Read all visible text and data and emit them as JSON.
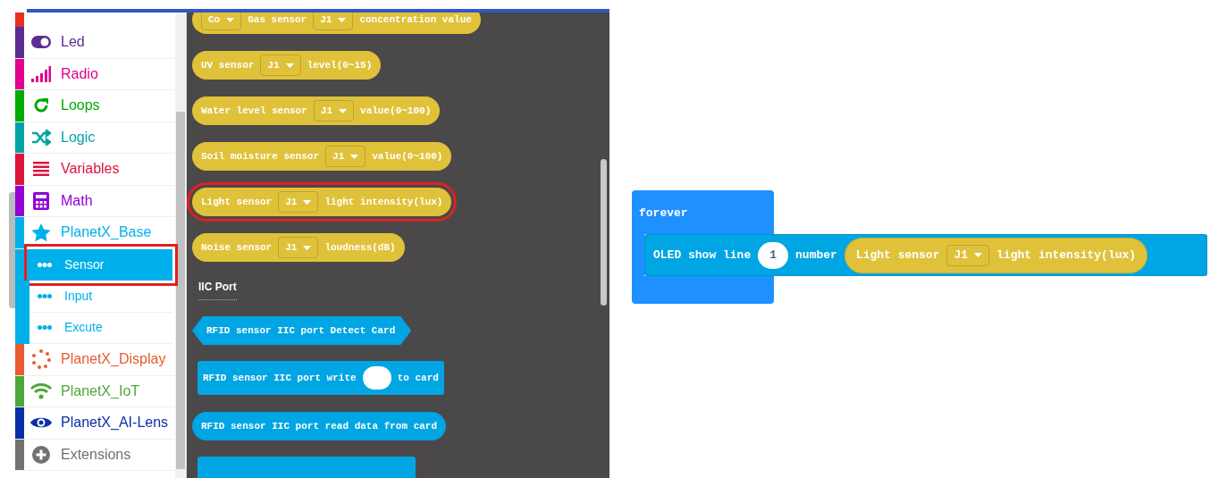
{
  "sidebar": {
    "items": [
      {
        "label": "Led",
        "color": "#5c2d91",
        "selected": false
      },
      {
        "label": "Radio",
        "color": "#e3008c",
        "selected": false
      },
      {
        "label": "Loops",
        "color": "#00aa00",
        "selected": false
      },
      {
        "label": "Logic",
        "color": "#00a4a6",
        "selected": false
      },
      {
        "label": "Variables",
        "color": "#dc143c",
        "selected": false
      },
      {
        "label": "Math",
        "color": "#9400d3",
        "selected": false
      },
      {
        "label": "PlanetX_Base",
        "color": "#00b0ea",
        "selected": false,
        "children": [
          {
            "label": "Sensor",
            "selected": true,
            "highlighted": true
          },
          {
            "label": "Input",
            "selected": false,
            "highlighted": false
          },
          {
            "label": "Excute",
            "selected": false,
            "highlighted": false
          }
        ]
      },
      {
        "label": "PlanetX_Display",
        "color": "#e95b30",
        "selected": false
      },
      {
        "label": "PlanetX_IoT",
        "color": "#4ea73a",
        "selected": false
      },
      {
        "label": "PlanetX_AI-Lens",
        "color": "#0a2ea8",
        "selected": false
      },
      {
        "label": "Extensions",
        "color": "#717171",
        "selected": false
      }
    ]
  },
  "flyout": {
    "items": [
      {
        "kind": "reporter",
        "color": "#e0c23a",
        "highlighted": false,
        "parts": [
          {
            "kind": "dropdown",
            "text": "Co"
          },
          {
            "kind": "text",
            "text": "Gas sensor"
          },
          {
            "kind": "dropdown",
            "text": "J1"
          },
          {
            "kind": "text",
            "text": "concentration value"
          }
        ]
      },
      {
        "kind": "reporter",
        "color": "#e0c23a",
        "highlighted": false,
        "parts": [
          {
            "kind": "text",
            "text": "UV sensor"
          },
          {
            "kind": "dropdown",
            "text": "J1"
          },
          {
            "kind": "text",
            "text": "level(0~15)"
          }
        ]
      },
      {
        "kind": "reporter",
        "color": "#e0c23a",
        "highlighted": false,
        "parts": [
          {
            "kind": "text",
            "text": "Water level sensor"
          },
          {
            "kind": "dropdown",
            "text": "J1"
          },
          {
            "kind": "text",
            "text": "value(0~100)"
          }
        ]
      },
      {
        "kind": "reporter",
        "color": "#e0c23a",
        "highlighted": false,
        "parts": [
          {
            "kind": "text",
            "text": "Soil moisture sensor"
          },
          {
            "kind": "dropdown",
            "text": "J1"
          },
          {
            "kind": "text",
            "text": "value(0~100)"
          }
        ]
      },
      {
        "kind": "reporter",
        "color": "#e0c23a",
        "highlighted": true,
        "parts": [
          {
            "kind": "text",
            "text": "Light sensor"
          },
          {
            "kind": "dropdown",
            "text": "J1"
          },
          {
            "kind": "text",
            "text": "light intensity(lux)"
          }
        ]
      },
      {
        "kind": "reporter",
        "color": "#e0c23a",
        "highlighted": false,
        "parts": [
          {
            "kind": "text",
            "text": "Noise sensor"
          },
          {
            "kind": "dropdown",
            "text": "J1"
          },
          {
            "kind": "text",
            "text": "loudness(dB)"
          }
        ]
      },
      {
        "kind": "heading",
        "text": "IIC Port"
      },
      {
        "kind": "boolean",
        "color": "#00a5e3",
        "highlighted": false,
        "parts": [
          {
            "kind": "text",
            "text": "RFID sensor IIC port Detect Card"
          }
        ]
      },
      {
        "kind": "statement",
        "color": "#00a5e3",
        "highlighted": false,
        "parts": [
          {
            "kind": "text",
            "text": "RFID sensor IIC port write"
          },
          {
            "kind": "string"
          },
          {
            "kind": "text",
            "text": "to card"
          }
        ]
      },
      {
        "kind": "reporter",
        "color": "#00a5e3",
        "highlighted": false,
        "parts": [
          {
            "kind": "text",
            "text": "RFID sensor IIC port read data from card"
          }
        ]
      },
      {
        "kind": "partial",
        "color": "#00a5e3"
      }
    ]
  },
  "workspace": {
    "forever": {
      "label": "forever",
      "color": "#1e90ff"
    },
    "statement": {
      "color": "#00a5e3",
      "parts": [
        {
          "kind": "text",
          "text": "OLED show line"
        },
        {
          "kind": "number",
          "text": "1"
        },
        {
          "kind": "text",
          "text": "number"
        },
        {
          "kind": "reporter",
          "color": "#e0c23a",
          "parts": [
            {
              "kind": "text",
              "text": "Light sensor"
            },
            {
              "kind": "dropdown",
              "text": "J1"
            },
            {
              "kind": "text",
              "text": "light intensity(lux)"
            }
          ]
        }
      ]
    }
  }
}
